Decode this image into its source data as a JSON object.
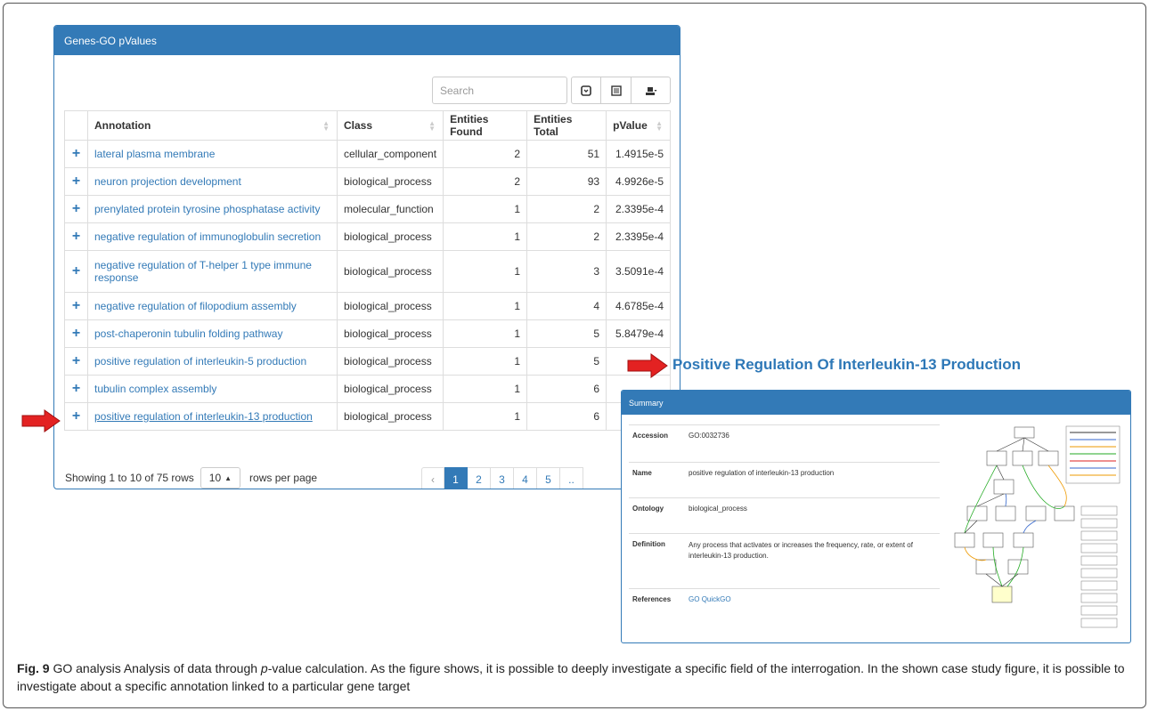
{
  "panel": {
    "title": "Genes-GO pValues",
    "search_placeholder": "Search",
    "icons": [
      "refresh-icon",
      "columns-icon",
      "export-icon"
    ]
  },
  "table": {
    "headers": [
      "Annotation",
      "Class",
      "Entities Found",
      "Entities Total",
      "pValue"
    ],
    "rows": [
      {
        "annotation": "lateral plasma membrane",
        "class": "cellular_component",
        "found": "2",
        "total": "51",
        "pvalue": "1.4915e-5"
      },
      {
        "annotation": "neuron projection development",
        "class": "biological_process",
        "found": "2",
        "total": "93",
        "pvalue": "4.9926e-5"
      },
      {
        "annotation": "prenylated protein tyrosine phosphatase activity",
        "class": "molecular_function",
        "found": "1",
        "total": "2",
        "pvalue": "2.3395e-4"
      },
      {
        "annotation": "negative regulation of immunoglobulin secretion",
        "class": "biological_process",
        "found": "1",
        "total": "2",
        "pvalue": "2.3395e-4"
      },
      {
        "annotation": "negative regulation of T-helper 1 type immune response",
        "class": "biological_process",
        "found": "1",
        "total": "3",
        "pvalue": "3.5091e-4"
      },
      {
        "annotation": "negative regulation of filopodium assembly",
        "class": "biological_process",
        "found": "1",
        "total": "4",
        "pvalue": "4.6785e-4"
      },
      {
        "annotation": "post-chaperonin tubulin folding pathway",
        "class": "biological_process",
        "found": "1",
        "total": "5",
        "pvalue": "5.8479e-4"
      },
      {
        "annotation": "positive regulation of interleukin-5 production",
        "class": "biological_process",
        "found": "1",
        "total": "5",
        "pvalue": ""
      },
      {
        "annotation": "tubulin complex assembly",
        "class": "biological_process",
        "found": "1",
        "total": "6",
        "pvalue": ""
      },
      {
        "annotation": "positive regulation of interleukin-13 production",
        "class": "biological_process",
        "found": "1",
        "total": "6",
        "pvalue": ""
      }
    ]
  },
  "footer": {
    "showing": "Showing 1 to 10 of 75 rows",
    "page_size": "10",
    "rows_per_page": "rows per page",
    "pages": [
      "‹",
      "1",
      "2",
      "3",
      "4",
      "5",
      ".."
    ]
  },
  "detail": {
    "title": "Positive Regulation Of Interleukin-13 Production",
    "summary_label": "Summary",
    "accession_label": "Accession",
    "accession": "GO:0032736",
    "name_label": "Name",
    "name": "positive regulation of interleukin-13 production",
    "ontology_label": "Ontology",
    "ontology": "biological_process",
    "definition_label": "Definition",
    "definition": "Any process that activates or increases the frequency, rate, or extent of interleukin-13 production.",
    "references_label": "References",
    "ref_go": "GO",
    "ref_quickgo": "QuickGO"
  },
  "caption": {
    "label": "Fig. 9",
    "text_a": " GO analysis Analysis of data through ",
    "p": "p",
    "text_b": "-value calculation. As the figure shows, it is possible to deeply investigate a specific field of the interrogation. In the shown case study figure, it is possible to investigate about a specific annotation linked to a particular gene target"
  },
  "colors": {
    "primary": "#337ab7",
    "arrow": "#e32222"
  }
}
